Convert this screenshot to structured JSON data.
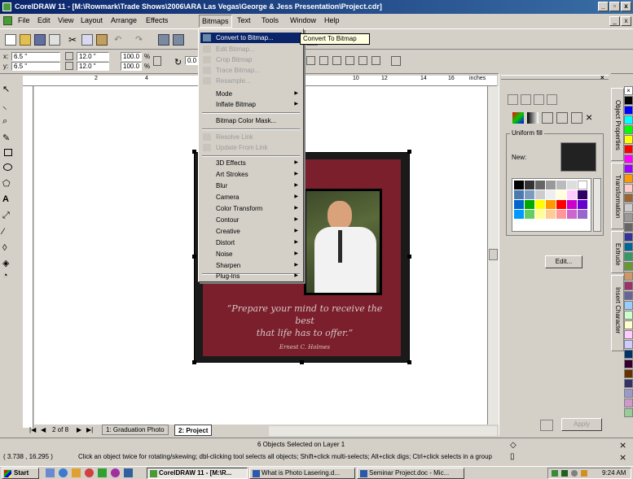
{
  "window": {
    "title": "CorelDRAW 11 - [M:\\Rowmark\\Trade Shows\\2006\\ARA Las Vegas\\George & Jess Presentation\\Project.cdr]",
    "minimize": "_",
    "maximize": "▫",
    "close": "x"
  },
  "menubar": {
    "items": [
      "File",
      "Edit",
      "View",
      "Layout",
      "Arrange",
      "Effects",
      "Bitmaps",
      "Text",
      "Tools",
      "Window",
      "Help"
    ]
  },
  "propbar": {
    "x_label": "x:",
    "x_value": "6.5 \"",
    "y_label": "y:",
    "y_value": "6.5 \"",
    "w_value": "12.0 \"",
    "h_value": "12.0 \"",
    "scale_w": "100.0",
    "scale_h": "100.0",
    "scale_unit": "%",
    "rotation": "0.0",
    "units": "inches"
  },
  "bitmaps_menu": {
    "items": [
      {
        "label": "Convert to Bitmap...",
        "state": "highlight",
        "submenu": false,
        "icon": "convert-bitmap-icon"
      },
      {
        "label": "Edit Bitmap...",
        "state": "disabled",
        "submenu": false,
        "icon": "edit-bitmap-icon"
      },
      {
        "label": "Crop Bitmap",
        "state": "disabled",
        "submenu": false,
        "icon": "crop-bitmap-icon"
      },
      {
        "label": "Trace Bitmap...",
        "state": "disabled",
        "submenu": false,
        "icon": "trace-bitmap-icon"
      },
      {
        "label": "Resample...",
        "state": "disabled",
        "submenu": false,
        "icon": "resample-icon"
      },
      {
        "label": "Mode",
        "state": "normal",
        "submenu": true
      },
      {
        "label": "Inflate Bitmap",
        "state": "normal",
        "submenu": true
      },
      {
        "label": "Bitmap Color Mask...",
        "state": "normal",
        "submenu": false
      },
      {
        "label": "Resolve Link",
        "state": "disabled",
        "submenu": false,
        "icon": "resolve-link-icon"
      },
      {
        "label": "Update From Link",
        "state": "disabled",
        "submenu": false,
        "icon": "update-link-icon"
      },
      {
        "label": "3D Effects",
        "state": "normal",
        "submenu": true
      },
      {
        "label": "Art Strokes",
        "state": "normal",
        "submenu": true
      },
      {
        "label": "Blur",
        "state": "normal",
        "submenu": true
      },
      {
        "label": "Camera",
        "state": "normal",
        "submenu": true
      },
      {
        "label": "Color Transform",
        "state": "normal",
        "submenu": true
      },
      {
        "label": "Contour",
        "state": "normal",
        "submenu": true
      },
      {
        "label": "Creative",
        "state": "normal",
        "submenu": true
      },
      {
        "label": "Distort",
        "state": "normal",
        "submenu": true
      },
      {
        "label": "Noise",
        "state": "normal",
        "submenu": true
      },
      {
        "label": "Sharpen",
        "state": "normal",
        "submenu": true
      },
      {
        "label": "Plug-Ins",
        "state": "normal",
        "submenu": true
      }
    ],
    "tooltip": "Convert To Bitmap"
  },
  "ruler": {
    "ticks": [
      "2",
      "4",
      "10",
      "12",
      "14",
      "16"
    ],
    "units": "inches"
  },
  "canvas": {
    "quote_line1": "“Prepare your mind to receive the best",
    "quote_line2": "that life has to offer.”",
    "signature": "Ernest C. Holmes"
  },
  "page_tabs": {
    "counter": "2 of 8",
    "tabs": [
      "1: Graduation Photo",
      "2: Project"
    ]
  },
  "docker": {
    "section_label": "Uniform fill",
    "new_label": "New:",
    "edit_button": "Edit...",
    "apply_button": "Apply",
    "side_tabs": [
      "Object Properties",
      "Transformation",
      "Extrude",
      "Insert Character"
    ]
  },
  "status": {
    "center_text": "6 Objects Selected on Layer 1",
    "coords": "( 3.738 , 16.295 )",
    "hint": "Click an object twice for rotating/skewing; dbl-clicking tool selects all objects; Shift+click multi-selects; Alt+click digs; Ctrl+click selects in a group"
  },
  "taskbar": {
    "start": "Start",
    "tasks": [
      "CorelDRAW 11 - [M:\\R...",
      "What is Photo Lasering.d...",
      "Seminar Project.doc - Mic..."
    ],
    "time": "9:24 AM"
  },
  "colors": {
    "title_blue": "#0a246a",
    "poster_maroon": "#7a1f2b",
    "menu_highlight": "#0a246a"
  }
}
